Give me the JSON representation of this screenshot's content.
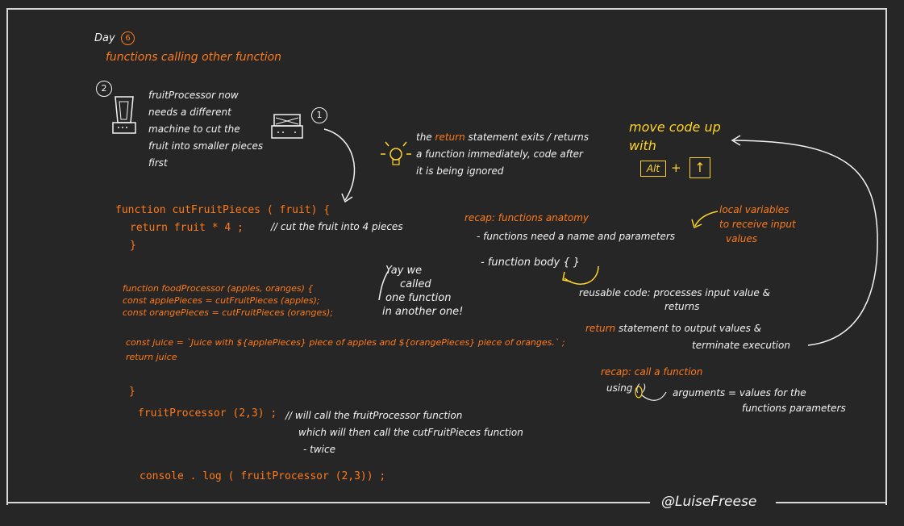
{
  "header": {
    "day_label": "Day",
    "day_number": "6",
    "title": "functions calling other function"
  },
  "note": {
    "marker": "2",
    "lines": [
      "fruitProcessor now",
      "needs a different",
      "machine to cut the",
      "fruit into smaller pieces",
      "first"
    ]
  },
  "machine_marker": "1",
  "tip": {
    "line1_pre": "the",
    "line1_keyword": "return",
    "line1_post": "statement exits / returns",
    "line2": "a function immediately, code after",
    "line3": "it is being ignored"
  },
  "shortcut": {
    "title_line1": "move code up",
    "title_line2": "with",
    "key1": "Alt",
    "plus": "+",
    "key2": "↑"
  },
  "code_cut": {
    "line1": "function cutFruitPieces ( fruit) {",
    "line2": "return  fruit * 4 ;",
    "comment": "// cut the fruit into 4 pieces",
    "close": "}"
  },
  "recap_anatomy": {
    "label": "recap: functions anatomy",
    "item1": "- functions need a name and parameters",
    "item2": "- function body  {   }",
    "local_vars": [
      "local variables",
      "to receive input",
      "values"
    ],
    "reusable": [
      "reusable code:  processes input value &",
      "returns"
    ],
    "return_stmt_keyword": "return",
    "return_stmt_rest": "statement to output values &",
    "return_stmt_line2": "terminate execution"
  },
  "yay": [
    "Yay we",
    "called",
    "one function",
    "in another one!"
  ],
  "code_food": {
    "line1": "function foodProcessor (apples, oranges) {",
    "line2": "const applePieces = cutFruitPieces (apples);",
    "line3": "const orangePieces = cutFruitPieces (oranges);",
    "line4": "const juice = `Juice with ${applePieces} piece of apples and ${orangePieces} piece of oranges.` ;",
    "line5": "return juice",
    "close": "}"
  },
  "recap_call": {
    "label": "recap: call a function",
    "using": "using ( )",
    "args": [
      "arguments = values for the",
      "functions parameters"
    ]
  },
  "call": {
    "code": "fruitProcessor (2,3) ;",
    "comment": [
      "// will call the fruitProcessor function",
      "which will then call the  cutFruitPieces function",
      "- twice"
    ],
    "console": "console . log ( fruitProcessor (2,3)) ;"
  },
  "signature": "@LuiseFreese",
  "colors": {
    "background": "#262626",
    "ink": "#f2f2f2",
    "accent": "#ff7a1a",
    "highlight": "#ffd426"
  }
}
